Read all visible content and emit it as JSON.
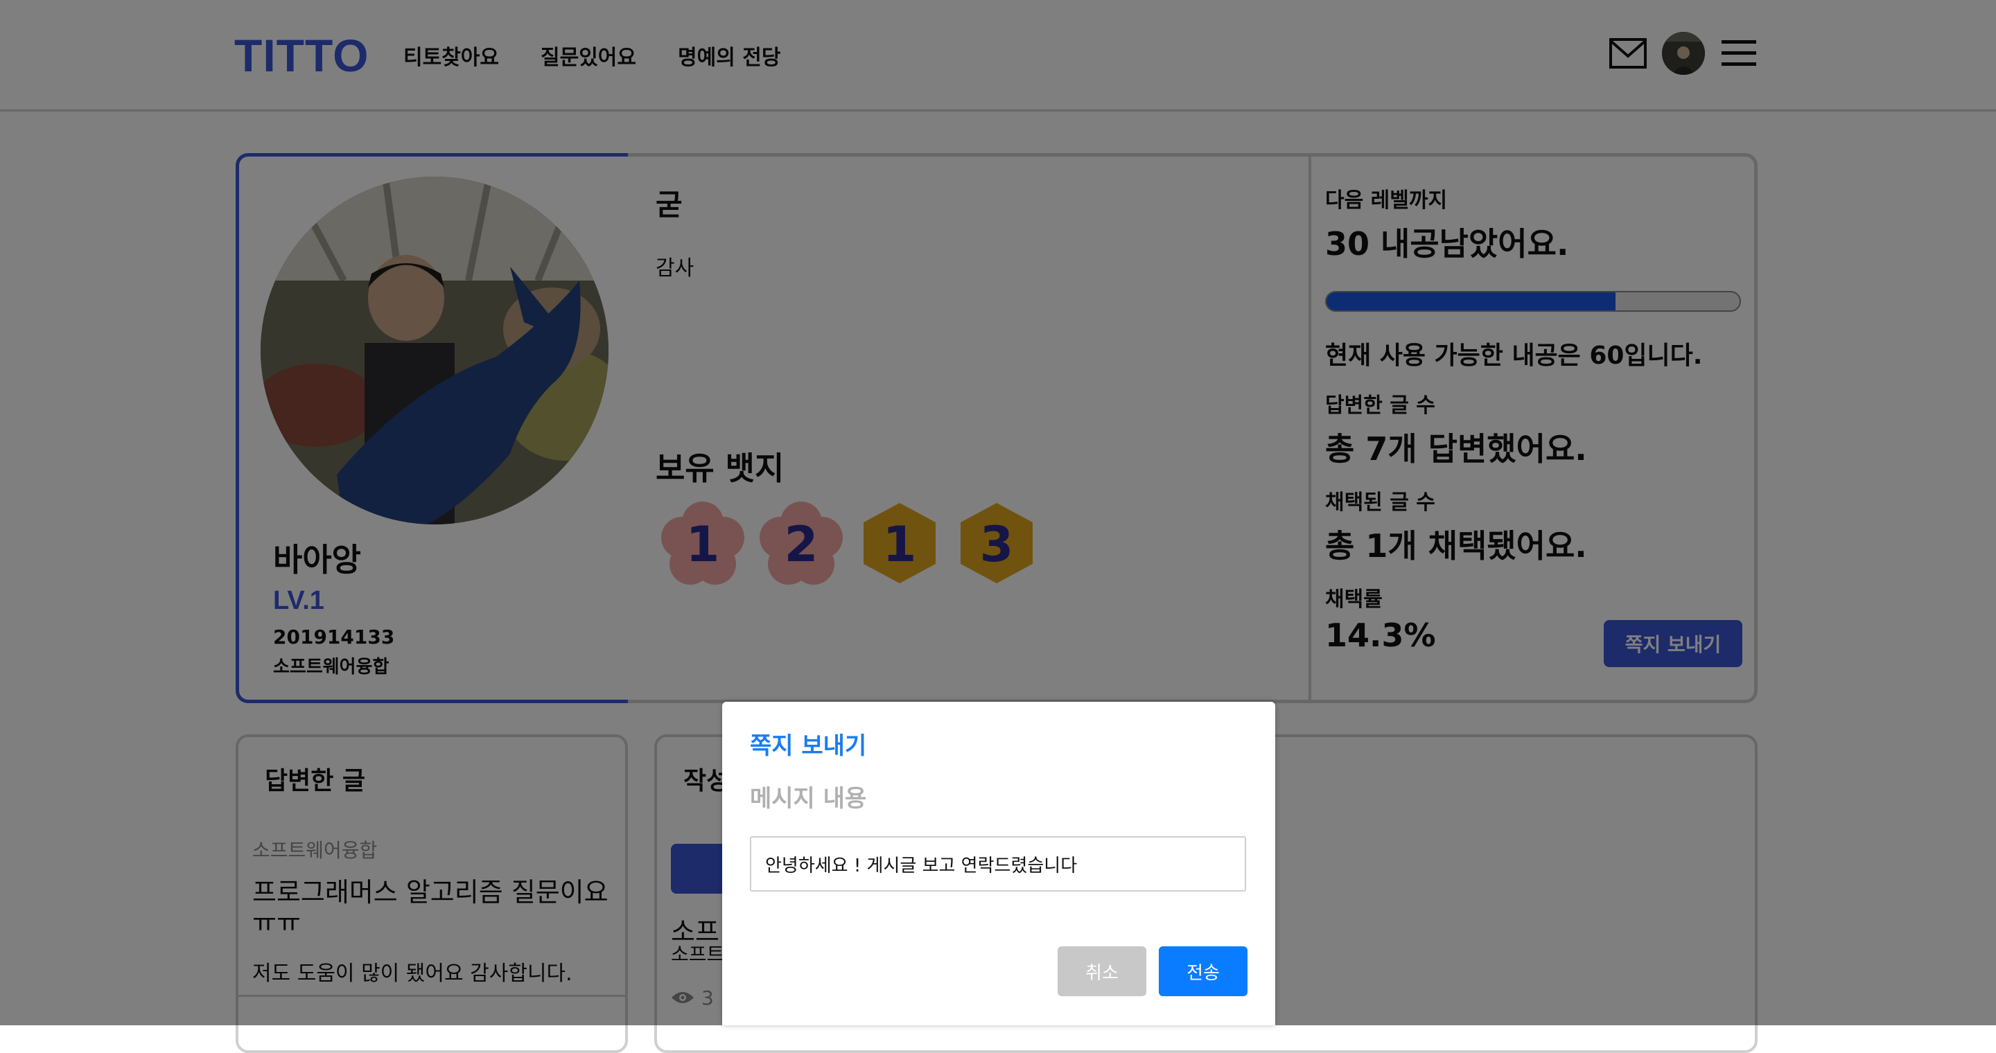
{
  "header": {
    "logo": "TITTO",
    "nav": [
      "티토찾아요",
      "질문있어요",
      "명예의 전당"
    ],
    "icons": [
      "mail-icon",
      "avatar",
      "hamburger-menu-icon"
    ]
  },
  "profile": {
    "name": "바아앙",
    "level": "LV.1",
    "student_id": "201914133",
    "major": "소프트웨어융합",
    "nickname": "굳",
    "bio": "감사",
    "badges_title": "보유 뱃지",
    "badges": [
      {
        "number": "1",
        "shape": "flower",
        "color": "#f4a6a6"
      },
      {
        "number": "2",
        "shape": "flower",
        "color": "#f4a6a6"
      },
      {
        "number": "1",
        "shape": "hexagon",
        "color": "#e0a520"
      },
      {
        "number": "3",
        "shape": "hexagon",
        "color": "#e0a520"
      }
    ]
  },
  "stats": {
    "next_level_label": "다음 레벨까지",
    "next_level_value": "30 내공남았어요.",
    "progress_fraction": 0.7,
    "available": "현재 사용 가능한 내공은 60입니다.",
    "answers_label": "답변한 글 수",
    "answers_value": "총 7개 답변했어요.",
    "adopted_label": "채택된 글 수",
    "adopted_value": "총 1개 채택됐어요.",
    "rate_label": "채택률",
    "rate_value": "14.3%",
    "send_note_button": "쪽지 보내기"
  },
  "answers_panel": {
    "title": "답변한 글",
    "category": "소프트웨어융합",
    "post_title": "프로그래머스 알고리즘 질문이요ㅠㅠ",
    "snippet": "저도 도움이 많이 됐어요 감사합니다."
  },
  "written_panel": {
    "title": "작성",
    "post_title": "소프",
    "post_sub": "소프트",
    "view_count": "3"
  },
  "modal": {
    "title": "쪽지 보내기",
    "label": "메시지 내용",
    "input_value": "안녕하세요 ! 게시글 보고 연락드렸습니다",
    "cancel": "취소",
    "send": "전송"
  },
  "colors": {
    "accent": "#3a56d6",
    "progress": "#1c59e3",
    "modal_accent": "#0a7cff"
  }
}
